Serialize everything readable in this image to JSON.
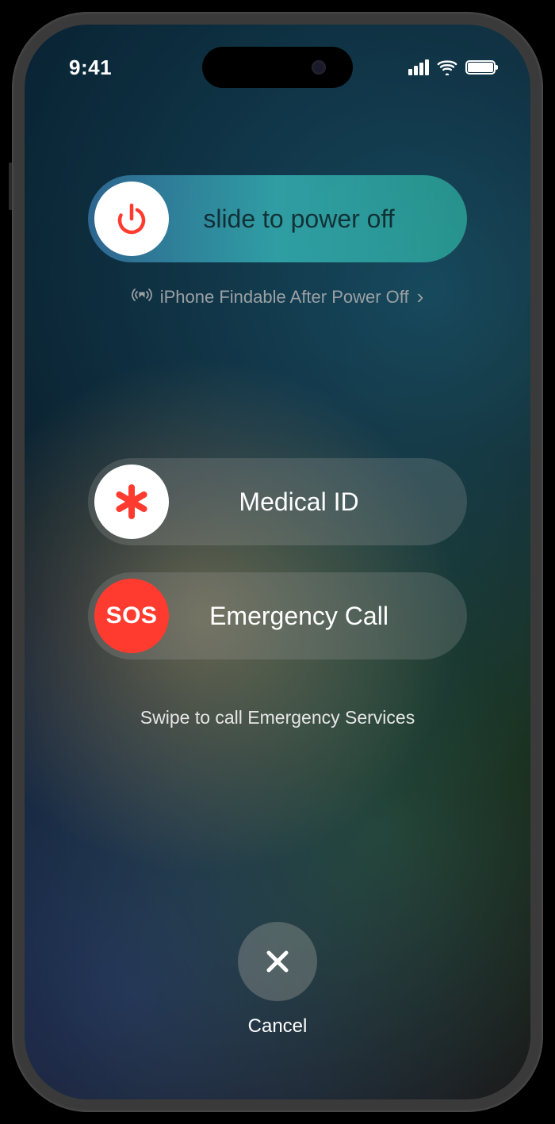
{
  "status": {
    "time": "9:41"
  },
  "power_slider": {
    "label": "slide to power off"
  },
  "findable": {
    "text": "iPhone Findable After Power Off"
  },
  "medical_slider": {
    "label": "Medical ID"
  },
  "sos_slider": {
    "label": "Emergency Call",
    "knob_text": "SOS"
  },
  "hint": "Swipe to call Emergency Services",
  "cancel": {
    "label": "Cancel"
  }
}
